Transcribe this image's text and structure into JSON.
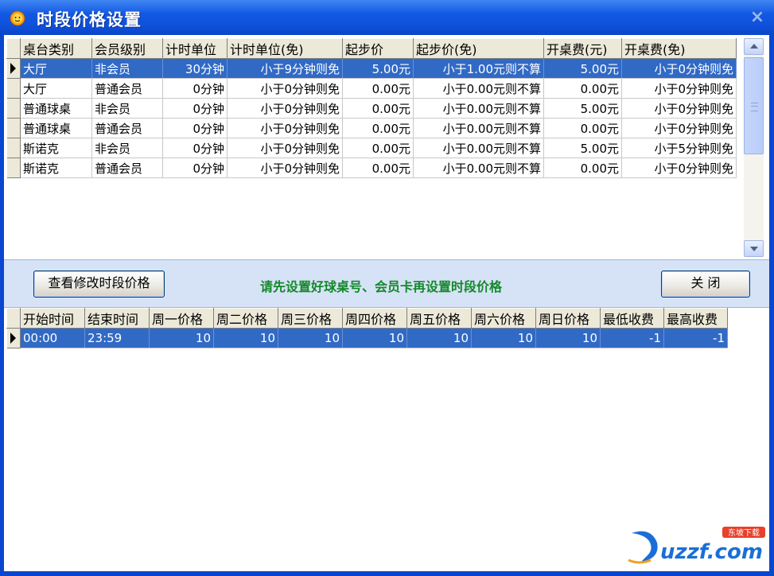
{
  "window": {
    "title": "时段价格设置",
    "close_glyph": "×"
  },
  "top_grid": {
    "headers": [
      "桌台类别",
      "会员级别",
      "计时单位",
      "计时单位(免)",
      "起步价",
      "起步价(免)",
      "开桌费(元)",
      "开桌费(免)"
    ],
    "rows": [
      [
        "大厅",
        "非会员",
        "30分钟",
        "小于9分钟则免",
        "5.00元",
        "小于1.00元则不算",
        "5.00元",
        "小于0分钟则免"
      ],
      [
        "大厅",
        "普通会员",
        "0分钟",
        "小于0分钟则免",
        "0.00元",
        "小于0.00元则不算",
        "0.00元",
        "小于0分钟则免"
      ],
      [
        "普通球桌",
        "非会员",
        "0分钟",
        "小于0分钟则免",
        "0.00元",
        "小于0.00元则不算",
        "5.00元",
        "小于0分钟则免"
      ],
      [
        "普通球桌",
        "普通会员",
        "0分钟",
        "小于0分钟则免",
        "0.00元",
        "小于0.00元则不算",
        "0.00元",
        "小于0分钟则免"
      ],
      [
        "斯诺克",
        "非会员",
        "0分钟",
        "小于0分钟则免",
        "0.00元",
        "小于0.00元则不算",
        "5.00元",
        "小于5分钟则免"
      ],
      [
        "斯诺克",
        "普通会员",
        "0分钟",
        "小于0分钟则免",
        "0.00元",
        "小于0.00元则不算",
        "0.00元",
        "小于0分钟则免"
      ]
    ],
    "selected_row": 0
  },
  "panel": {
    "view_button": "查看修改时段价格",
    "hint": "请先设置好球桌号、会员卡再设置时段价格",
    "close_button": "关 闭"
  },
  "bottom_grid": {
    "headers": [
      "开始时间",
      "结束时间",
      "周一价格",
      "周二价格",
      "周三价格",
      "周四价格",
      "周五价格",
      "周六价格",
      "周日价格",
      "最低收费",
      "最高收费"
    ],
    "rows": [
      [
        "00:00",
        "23:59",
        "10",
        "10",
        "10",
        "10",
        "10",
        "10",
        "10",
        "-1",
        "-1"
      ]
    ],
    "selected_row": 0
  },
  "watermark": {
    "brand": "uzzf.com",
    "tag": "东坡下载"
  },
  "colors": {
    "titlebar": "#0f52dc",
    "selection": "#316ac5",
    "hint": "#14882a",
    "panel": "#d6e3f6"
  }
}
